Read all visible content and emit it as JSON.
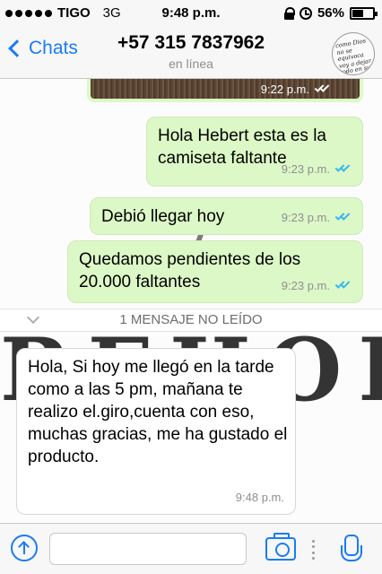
{
  "status_bar": {
    "carrier": "TIGO",
    "network": "3G",
    "time": "9:48 p.m.",
    "battery": "56%",
    "battery_level": 0.56
  },
  "nav": {
    "back_label": "Chats",
    "contact_name": "+57 315 7837962",
    "contact_status": "en línea",
    "avatar_text": "como Dios no se equivoca voy a dejar todo en sus manos"
  },
  "messages": [
    {
      "type": "image",
      "direction": "out",
      "time": "9:22 p.m."
    },
    {
      "type": "text",
      "direction": "out",
      "text": "Hola Hebert esta es la camiseta faltante",
      "time": "9:23 p.m."
    },
    {
      "type": "text",
      "direction": "out",
      "text": "Debió llegar hoy",
      "time": "9:23 p.m."
    },
    {
      "type": "text",
      "direction": "out",
      "text": "Quedamos pendientes de los 20.000 faltantes",
      "time": "9:23 p.m."
    },
    {
      "type": "text",
      "direction": "in",
      "text": "Hola, Si hoy me llegó en la tarde como a las 5 pm, mañana te realizo el.giro,cuenta con eso, muchas gracias, me ha gustado el producto.",
      "time": "9:48 p.m."
    }
  ],
  "unread_banner": "1 MENSAJE NO LEÍDO",
  "background_art_text": "REHOLA",
  "input_bar": {
    "placeholder": ""
  },
  "colors": {
    "accent": "#1a7cf5",
    "outgoing_bubble": "#dcf8c6",
    "incoming_bubble": "#ffffff",
    "read_ticks": "#34b7f1"
  }
}
